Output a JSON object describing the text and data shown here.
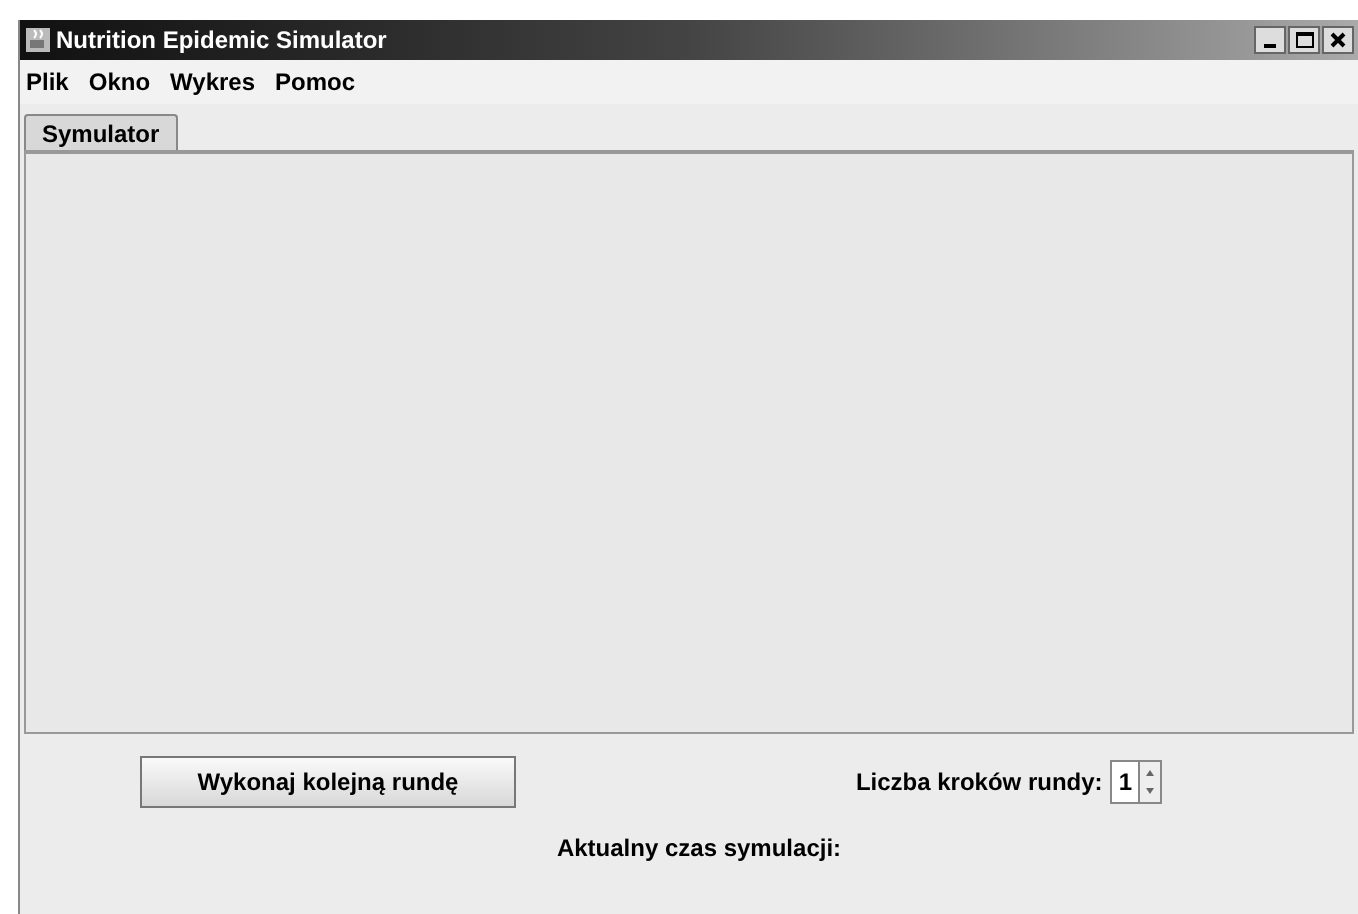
{
  "window": {
    "title": "Nutrition Epidemic Simulator"
  },
  "menu": [
    "Plik",
    "Okno",
    "Wykres",
    "Pomoc"
  ],
  "tabs": [
    {
      "label": "Symulator",
      "selected": true
    }
  ],
  "controls": {
    "run_button": "Wykonaj kolejną rundę",
    "steps_label": "Liczba kroków rundy:",
    "steps_value": "1",
    "time_label": "Aktualny czas symulacji:"
  }
}
